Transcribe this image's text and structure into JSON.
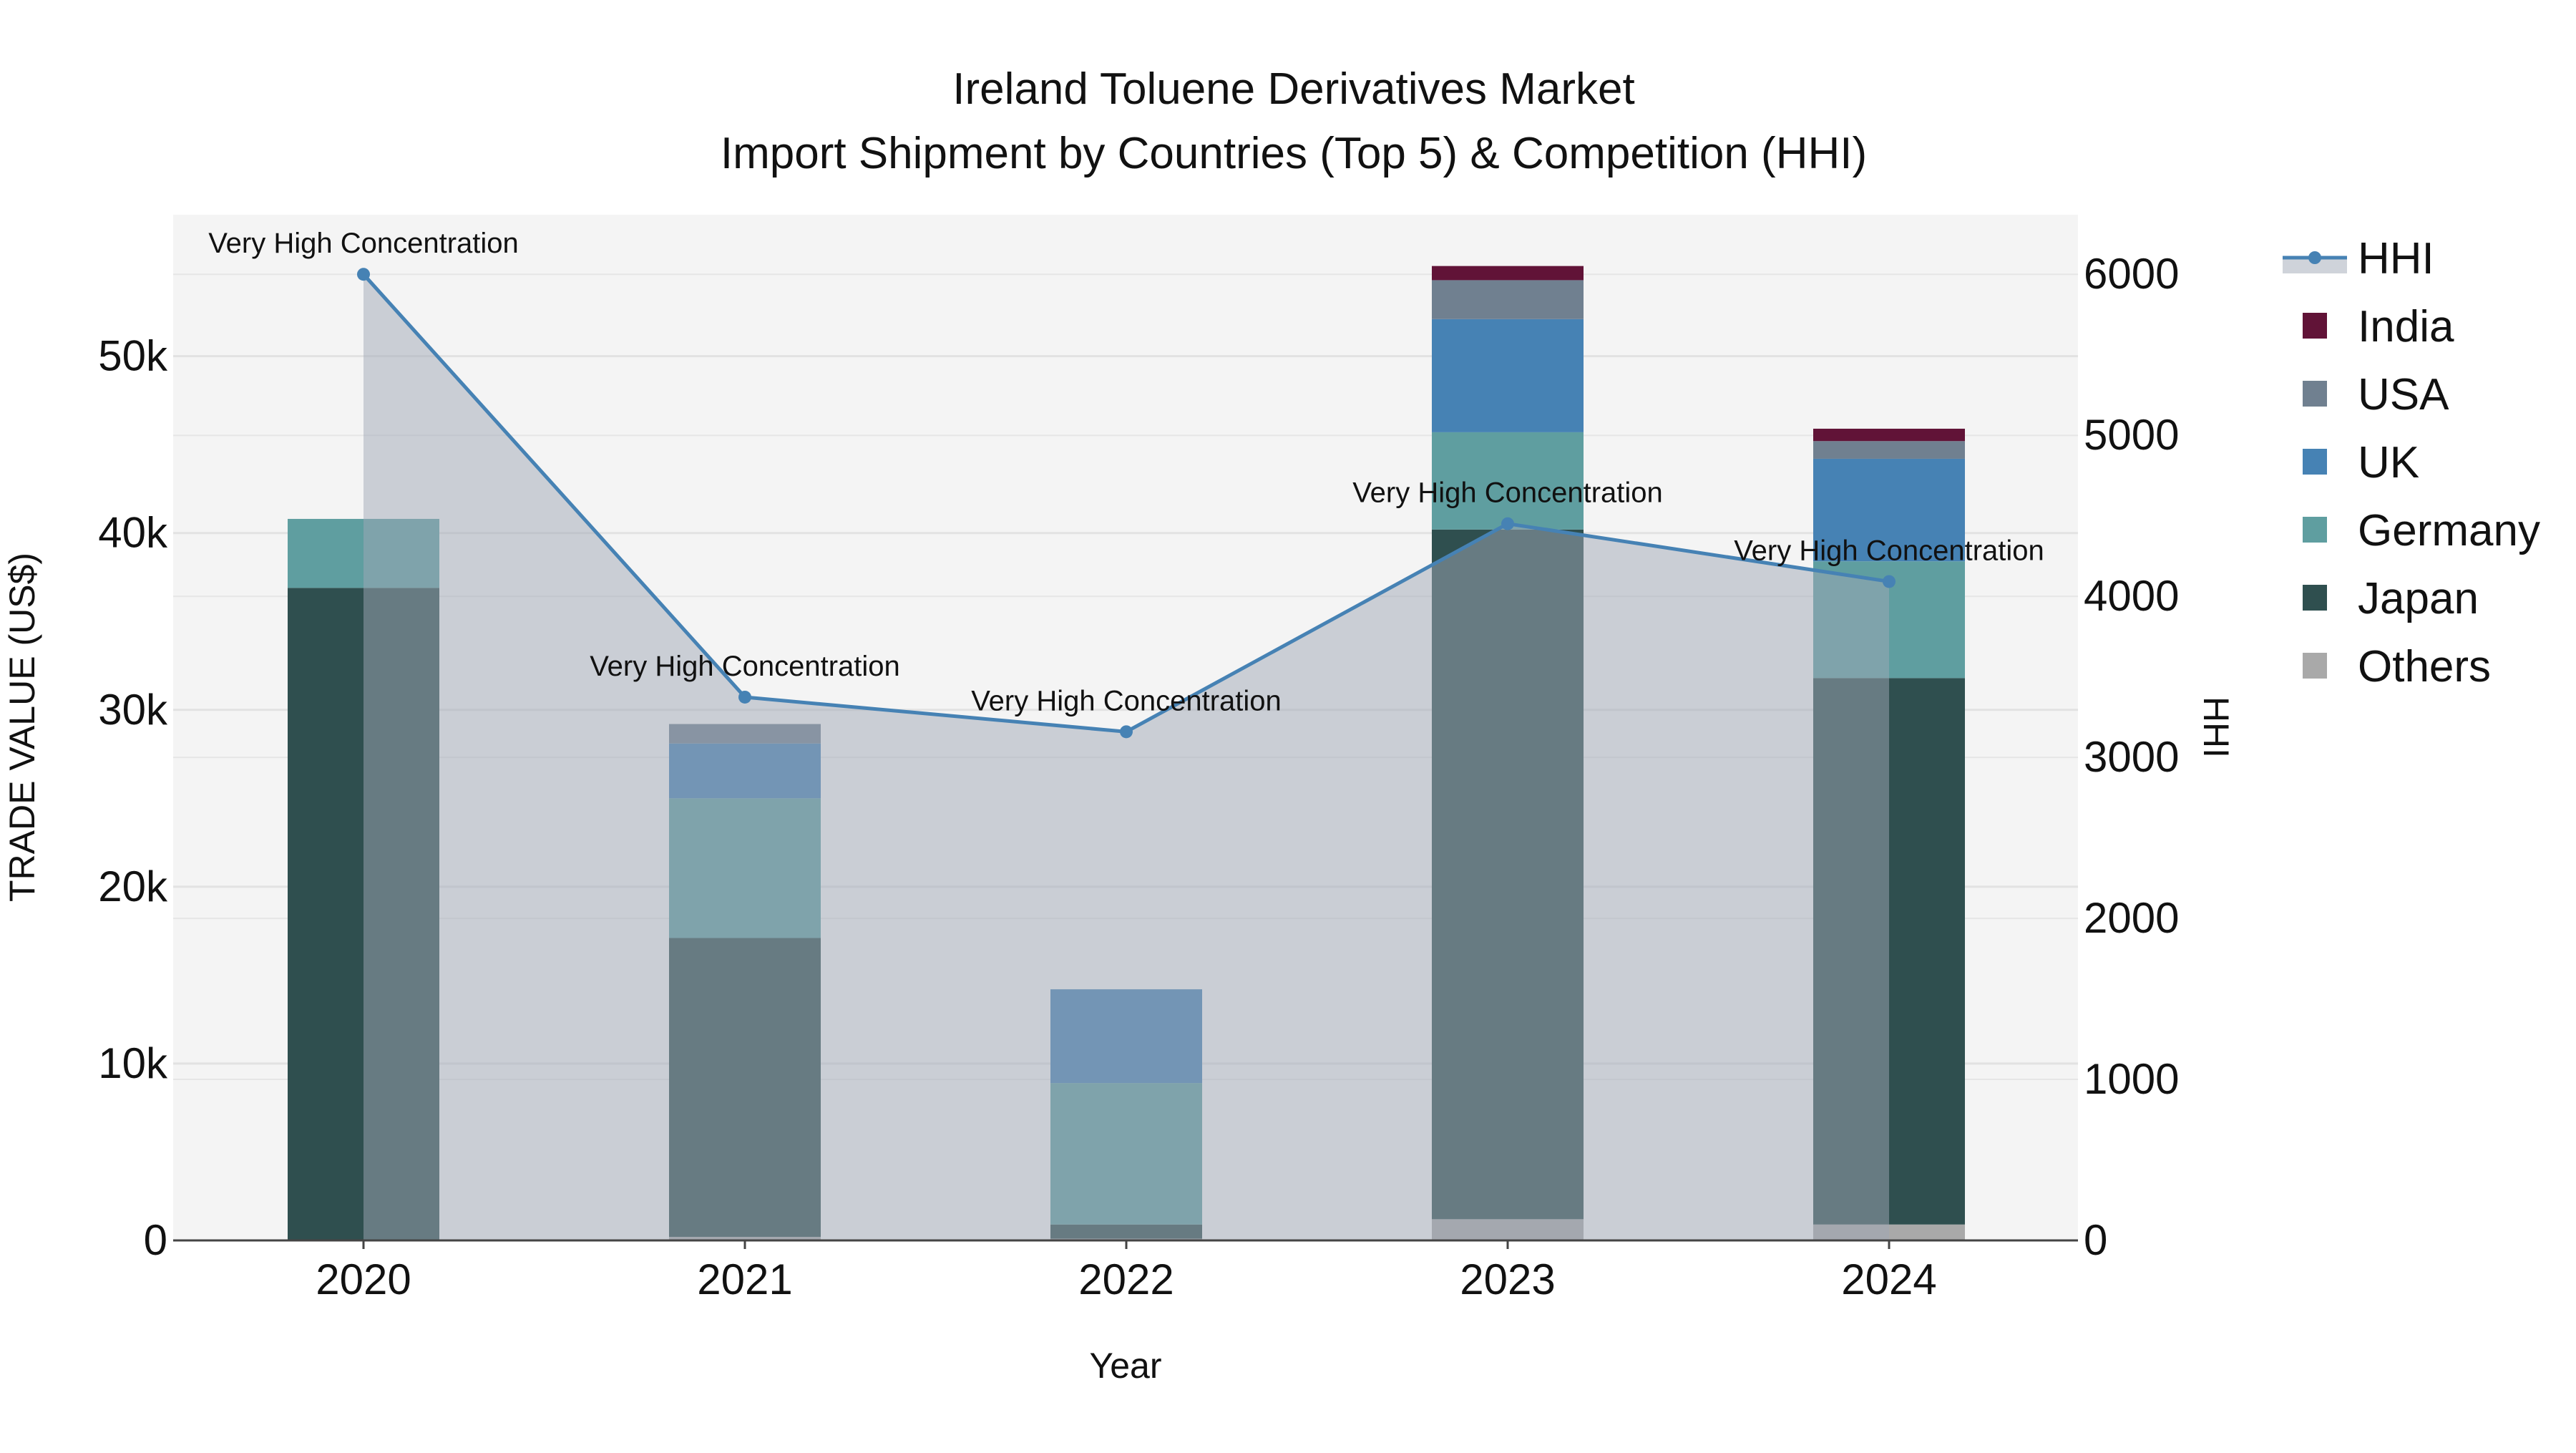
{
  "chart_data": {
    "type": "bar",
    "title_line1": "Ireland Toluene Derivatives Market",
    "title_line2": "Import Shipment by Countries (Top 5) & Competition (HHI)",
    "xlabel": "Year",
    "ylabel": "TRADE VALUE (US$)",
    "y2label": "HHI",
    "categories": [
      "2020",
      "2021",
      "2022",
      "2023",
      "2024"
    ],
    "ylim": [
      0,
      58000
    ],
    "y2lim": [
      0,
      6370
    ],
    "yticks": [
      0,
      10000,
      20000,
      30000,
      40000,
      50000
    ],
    "ytick_labels": [
      "0",
      "10k",
      "20k",
      "30k",
      "40k",
      "50k"
    ],
    "y2ticks": [
      0,
      1000,
      2000,
      3000,
      4000,
      5000,
      6000
    ],
    "y2tick_labels": [
      "0",
      "1000",
      "2000",
      "3000",
      "4000",
      "5000",
      "6000"
    ],
    "grid": true,
    "legend_position": "right",
    "series": [
      {
        "name": "Others",
        "color": "#A9A9A9",
        "values": [
          0,
          200,
          100,
          1200,
          900
        ]
      },
      {
        "name": "Japan",
        "color": "#2F4F4F",
        "values": [
          36900,
          16900,
          800,
          39000,
          30900
        ]
      },
      {
        "name": "Germany",
        "color": "#5F9EA0",
        "values": [
          3900,
          7900,
          8000,
          5500,
          6600
        ]
      },
      {
        "name": "UK",
        "color": "#4682B4",
        "values": [
          0,
          3100,
          5300,
          6400,
          5800
        ]
      },
      {
        "name": "USA",
        "color": "#708090",
        "values": [
          0,
          1100,
          0,
          2200,
          1000
        ]
      },
      {
        "name": "India",
        "color": "#611337",
        "values": [
          0,
          0,
          0,
          800,
          700
        ]
      }
    ],
    "hhi": {
      "name": "HHI",
      "color": "#4682B4",
      "values": [
        6000,
        3374,
        3159,
        4451,
        4092
      ],
      "annotations": [
        "Very High Concentration",
        "Very High Concentration",
        "Very High Concentration",
        "Very High Concentration",
        "Very High Concentration"
      ]
    },
    "legend_order": [
      "HHI",
      "India",
      "USA",
      "UK",
      "Germany",
      "Japan",
      "Others"
    ]
  }
}
